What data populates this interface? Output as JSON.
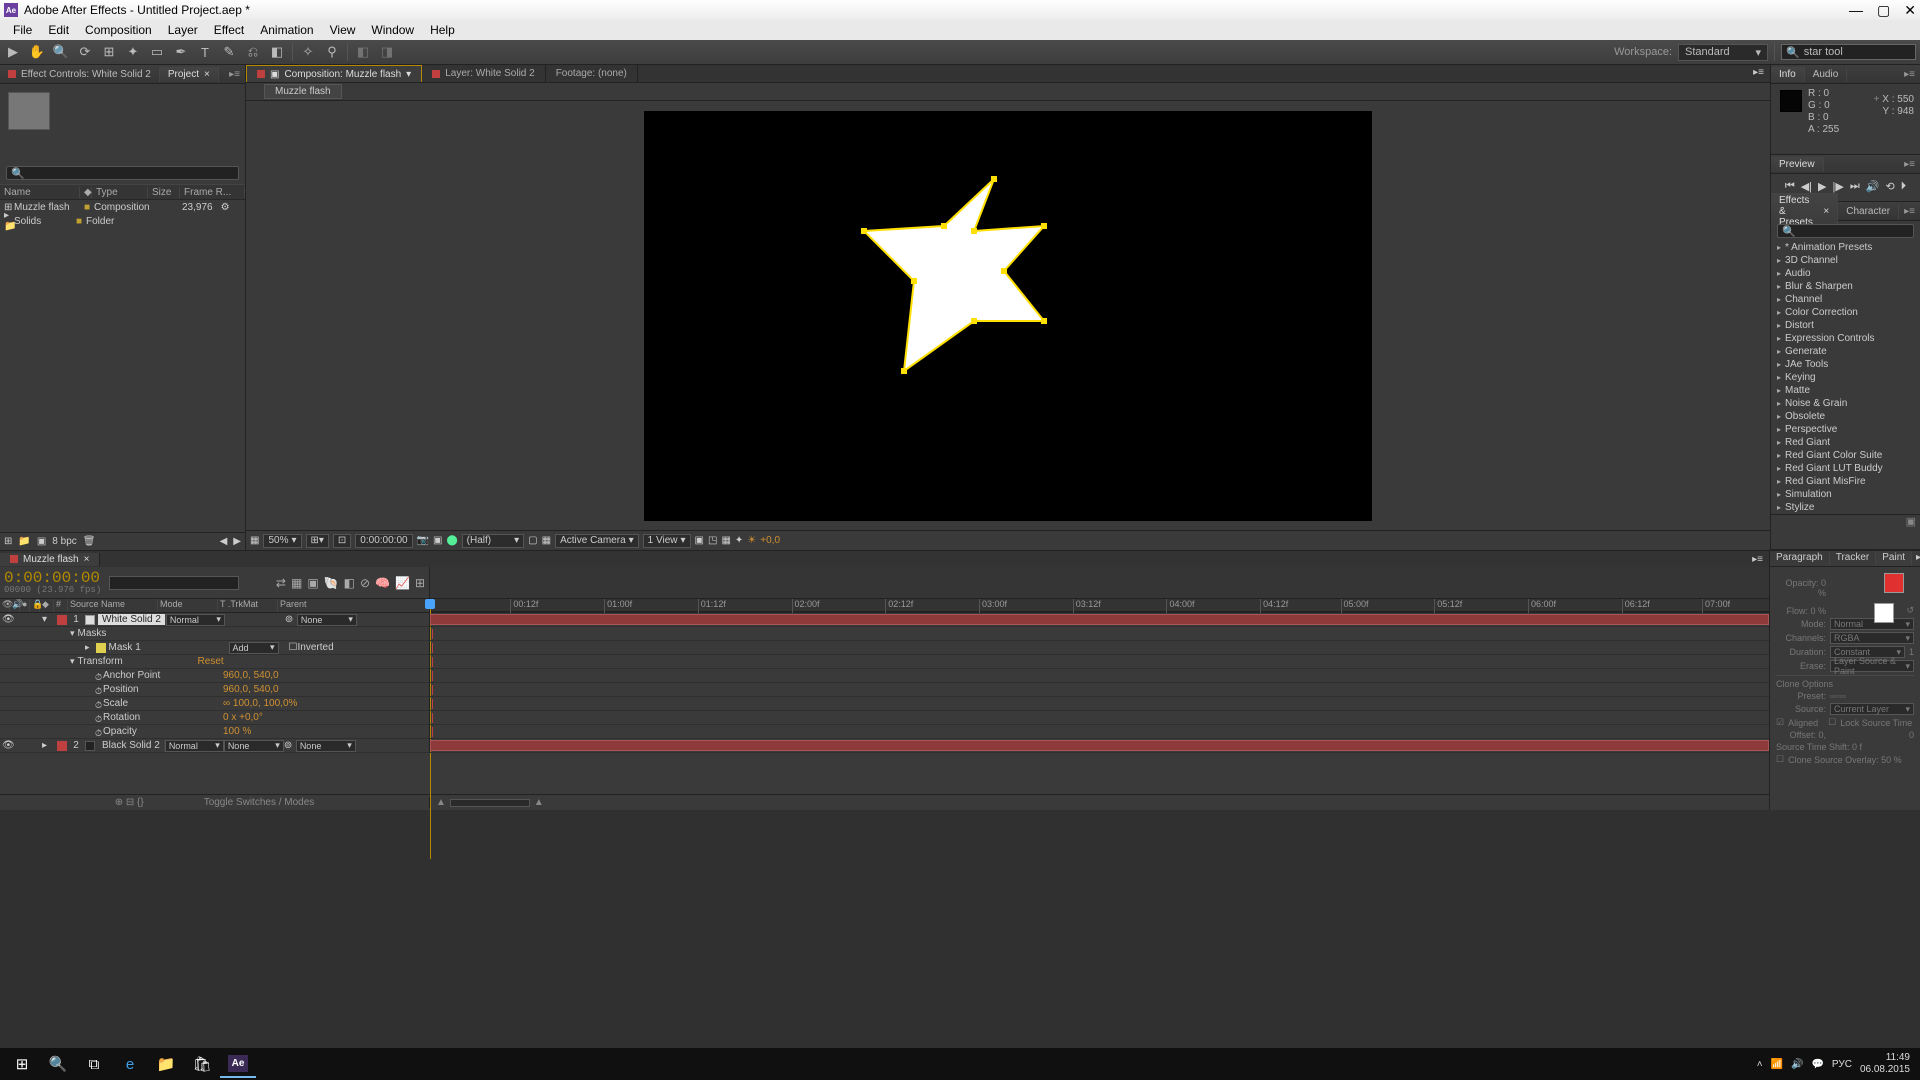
{
  "window": {
    "title": "Adobe After Effects - Untitled Project.aep *"
  },
  "menu": {
    "items": [
      "File",
      "Edit",
      "Composition",
      "Layer",
      "Effect",
      "Animation",
      "View",
      "Window",
      "Help"
    ]
  },
  "workspace": {
    "label": "Workspace:",
    "value": "Standard"
  },
  "search": {
    "icon": "🔍",
    "value": "star tool"
  },
  "project": {
    "tabs": {
      "effectcontrols": "Effect Controls: White Solid 2",
      "project": "Project"
    },
    "cols": {
      "name": "Name",
      "type": "Type",
      "size": "Size",
      "fr": "Frame R..."
    },
    "rows": [
      {
        "name": "Muzzle flash",
        "type": "Composition",
        "fr": "23,976"
      },
      {
        "name": "Solids",
        "type": "Folder",
        "fr": ""
      }
    ],
    "footer": {
      "bpc": "8 bpc"
    }
  },
  "composition": {
    "tabs": {
      "comp": "Composition: Muzzle flash",
      "layer": "Layer: White Solid 2",
      "footage": "Footage: (none)"
    },
    "bread": "Muzzle flash",
    "footer": {
      "zoom": "50%",
      "time": "0:00:00:00",
      "res": "(Half)",
      "camera": "Active Camera",
      "view": "1 View",
      "exp": "+0,0"
    }
  },
  "info": {
    "tabs": {
      "info": "Info",
      "audio": "Audio"
    },
    "r": "R : 0",
    "g": "G : 0",
    "b": "B : 0",
    "a": "A : 255",
    "x": "X : 550",
    "y": "Y : 948"
  },
  "preview": {
    "tab": "Preview"
  },
  "effects": {
    "tabs": {
      "ep": "Effects & Presets",
      "char": "Character"
    },
    "items": [
      "* Animation Presets",
      "3D Channel",
      "Audio",
      "Blur & Sharpen",
      "Channel",
      "Color Correction",
      "Distort",
      "Expression Controls",
      "Generate",
      "JAe Tools",
      "Keying",
      "Matte",
      "Noise & Grain",
      "Obsolete",
      "Perspective",
      "Red Giant",
      "Red Giant Color Suite",
      "Red Giant LUT Buddy",
      "Red Giant MisFire",
      "Simulation",
      "Stylize"
    ]
  },
  "timeline": {
    "tab": "Muzzle flash",
    "timecode": "0:00:00:00",
    "timecodesub": "00000 (23.976 fps)",
    "cols": {
      "idx": "#",
      "src": "Source Name",
      "mode": "Mode",
      "trk": "T  .TrkMat",
      "parent": "Parent"
    },
    "ticks": [
      "00:12f",
      "01:00f",
      "01:12f",
      "02:00f",
      "02:12f",
      "03:00f",
      "03:12f",
      "04:00f",
      "04:12f",
      "05:00f",
      "05:12f",
      "06:00f",
      "06:12f",
      "07:00f"
    ],
    "layers": [
      {
        "num": "1",
        "name": "White Solid 2",
        "mode": "Normal",
        "trk": "",
        "parent": "None"
      },
      {
        "num": "2",
        "name": "Black Solid 2",
        "mode": "Normal",
        "trk": "None",
        "parent": "None"
      }
    ],
    "l1": {
      "masks": "Masks",
      "mask1": {
        "name": "Mask 1",
        "mode": "Add",
        "inv": "Inverted"
      },
      "transform": "Transform",
      "reset": "Reset",
      "anchor": {
        "n": "Anchor Point",
        "v": "960,0, 540,0"
      },
      "position": {
        "n": "Position",
        "v": "960,0, 540,0"
      },
      "scale": {
        "n": "Scale",
        "v": "∞ 100,0, 100,0%"
      },
      "rotation": {
        "n": "Rotation",
        "v": "0 x +0,0°"
      },
      "opacity": {
        "n": "Opacity",
        "v": "100 %"
      }
    },
    "footer": {
      "toggle": "Toggle Switches / Modes"
    }
  },
  "rightbottom": {
    "tabs": [
      "Paragraph",
      "Tracker",
      "Paint"
    ],
    "paint": {
      "opacity": "Opacity: 0 %",
      "flow": "Flow: 0 %",
      "mode": "Mode:",
      "modev": "Normal",
      "channels": "Channels:",
      "channelsv": "RGBA",
      "duration": "Duration:",
      "durationv": "Constant",
      "durv2": "1",
      "erase": "Erase:",
      "erasev": "Layer Source & Paint",
      "clone": "Clone Options",
      "preset": "Preset:",
      "source": "Source:",
      "sourcev": "Current Layer",
      "aligned": "Aligned",
      "lock": "Lock Source Time",
      "offset": "Offset: 0,",
      "off2": "0",
      "shift": "Source Time Shift: 0  f",
      "overlay": "Clone Source Overlay:  50 %"
    }
  },
  "taskbar": {
    "lang": "РУС",
    "time": "11:49",
    "date": "06.08.2015"
  }
}
